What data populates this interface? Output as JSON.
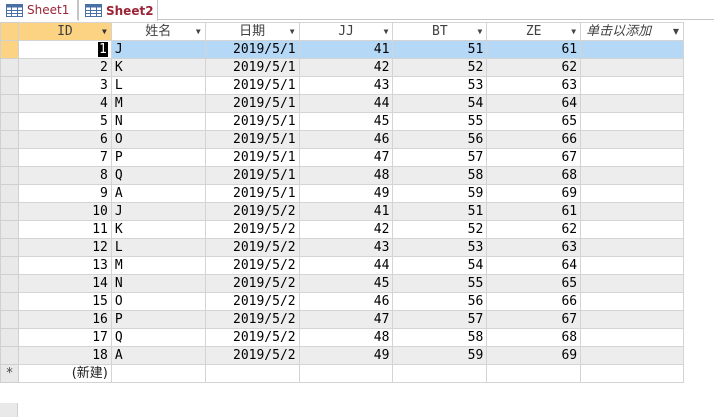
{
  "tabs": [
    {
      "label": "Sheet1",
      "active": false
    },
    {
      "label": "Sheet2",
      "active": true
    }
  ],
  "columns": [
    {
      "label": "ID"
    },
    {
      "label": "姓名"
    },
    {
      "label": "日期"
    },
    {
      "label": "JJ"
    },
    {
      "label": "BT"
    },
    {
      "label": "ZE"
    },
    {
      "label": "单击以添加"
    }
  ],
  "rows": [
    {
      "id": "1",
      "name": "J",
      "date": "2019/5/1",
      "jj": "41",
      "bt": "51",
      "ze": "61"
    },
    {
      "id": "2",
      "name": "K",
      "date": "2019/5/1",
      "jj": "42",
      "bt": "52",
      "ze": "62"
    },
    {
      "id": "3",
      "name": "L",
      "date": "2019/5/1",
      "jj": "43",
      "bt": "53",
      "ze": "63"
    },
    {
      "id": "4",
      "name": "M",
      "date": "2019/5/1",
      "jj": "44",
      "bt": "54",
      "ze": "64"
    },
    {
      "id": "5",
      "name": "N",
      "date": "2019/5/1",
      "jj": "45",
      "bt": "55",
      "ze": "65"
    },
    {
      "id": "6",
      "name": "O",
      "date": "2019/5/1",
      "jj": "46",
      "bt": "56",
      "ze": "66"
    },
    {
      "id": "7",
      "name": "P",
      "date": "2019/5/1",
      "jj": "47",
      "bt": "57",
      "ze": "67"
    },
    {
      "id": "8",
      "name": "Q",
      "date": "2019/5/1",
      "jj": "48",
      "bt": "58",
      "ze": "68"
    },
    {
      "id": "9",
      "name": "A",
      "date": "2019/5/1",
      "jj": "49",
      "bt": "59",
      "ze": "69"
    },
    {
      "id": "10",
      "name": "J",
      "date": "2019/5/2",
      "jj": "41",
      "bt": "51",
      "ze": "61"
    },
    {
      "id": "11",
      "name": "K",
      "date": "2019/5/2",
      "jj": "42",
      "bt": "52",
      "ze": "62"
    },
    {
      "id": "12",
      "name": "L",
      "date": "2019/5/2",
      "jj": "43",
      "bt": "53",
      "ze": "63"
    },
    {
      "id": "13",
      "name": "M",
      "date": "2019/5/2",
      "jj": "44",
      "bt": "54",
      "ze": "64"
    },
    {
      "id": "14",
      "name": "N",
      "date": "2019/5/2",
      "jj": "45",
      "bt": "55",
      "ze": "65"
    },
    {
      "id": "15",
      "name": "O",
      "date": "2019/5/2",
      "jj": "46",
      "bt": "56",
      "ze": "66"
    },
    {
      "id": "16",
      "name": "P",
      "date": "2019/5/2",
      "jj": "47",
      "bt": "57",
      "ze": "67"
    },
    {
      "id": "17",
      "name": "Q",
      "date": "2019/5/2",
      "jj": "48",
      "bt": "58",
      "ze": "68"
    },
    {
      "id": "18",
      "name": "A",
      "date": "2019/5/2",
      "jj": "49",
      "bt": "59",
      "ze": "69"
    }
  ],
  "new_row": {
    "marker": "*",
    "label": "(新建)"
  },
  "colors": {
    "accent_tab_text": "#9b2335",
    "selected_header": "#fcd383",
    "selected_row": "#b5d8f7"
  }
}
